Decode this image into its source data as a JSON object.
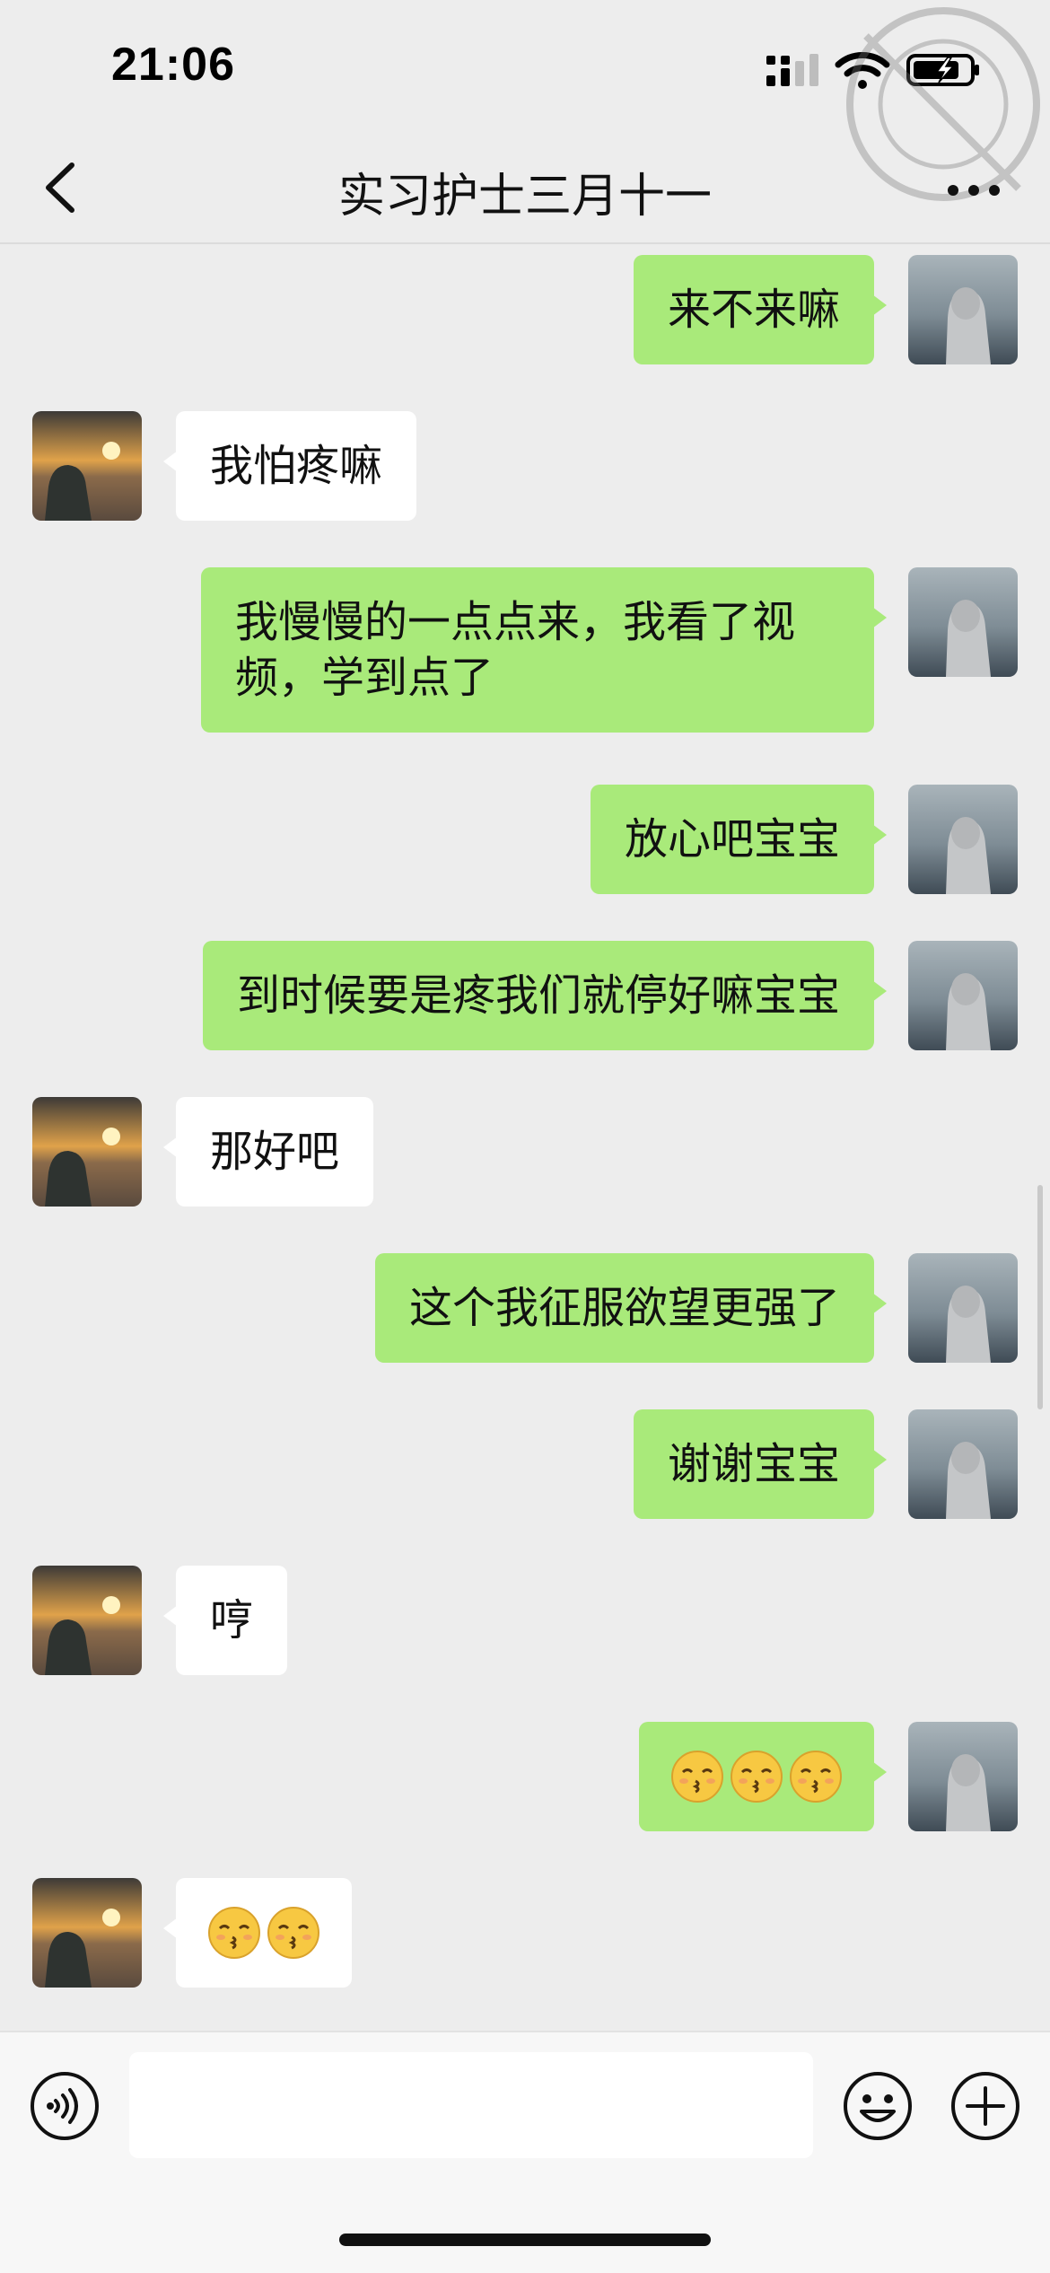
{
  "status_bar": {
    "time": "21:06",
    "icons": [
      "cellular-signal-icon",
      "wifi-icon",
      "battery-charging-icon"
    ]
  },
  "nav": {
    "title": "实习护士三月十一",
    "back_icon": "chevron-left-icon",
    "more_icon": "ellipsis-icon"
  },
  "messages": [
    {
      "sender": "me",
      "text": "来不来嘛"
    },
    {
      "sender": "them",
      "text": "我怕疼嘛"
    },
    {
      "sender": "me",
      "text": "我慢慢的一点点来，我看了视频，学到点了"
    },
    {
      "sender": "me",
      "text": "放心吧宝宝"
    },
    {
      "sender": "me",
      "text": "到时候要是疼我们就停好嘛宝宝"
    },
    {
      "sender": "them",
      "text": "那好吧"
    },
    {
      "sender": "me",
      "text": "这个我征服欲望更强了"
    },
    {
      "sender": "me",
      "text": "谢谢宝宝"
    },
    {
      "sender": "them",
      "text": "哼"
    },
    {
      "sender": "me",
      "emoji": [
        "kissing-face-icon",
        "kissing-face-icon",
        "kissing-face-icon"
      ]
    },
    {
      "sender": "them",
      "emoji": [
        "kissing-face-icon",
        "kissing-face-icon"
      ]
    }
  ],
  "input_bar": {
    "value": "",
    "icons": [
      "voice-icon",
      "smiley-icon",
      "plus-icon"
    ]
  },
  "colors": {
    "background": "#ededed",
    "my_bubble": "#a9ea7a",
    "their_bubble": "#ffffff"
  }
}
